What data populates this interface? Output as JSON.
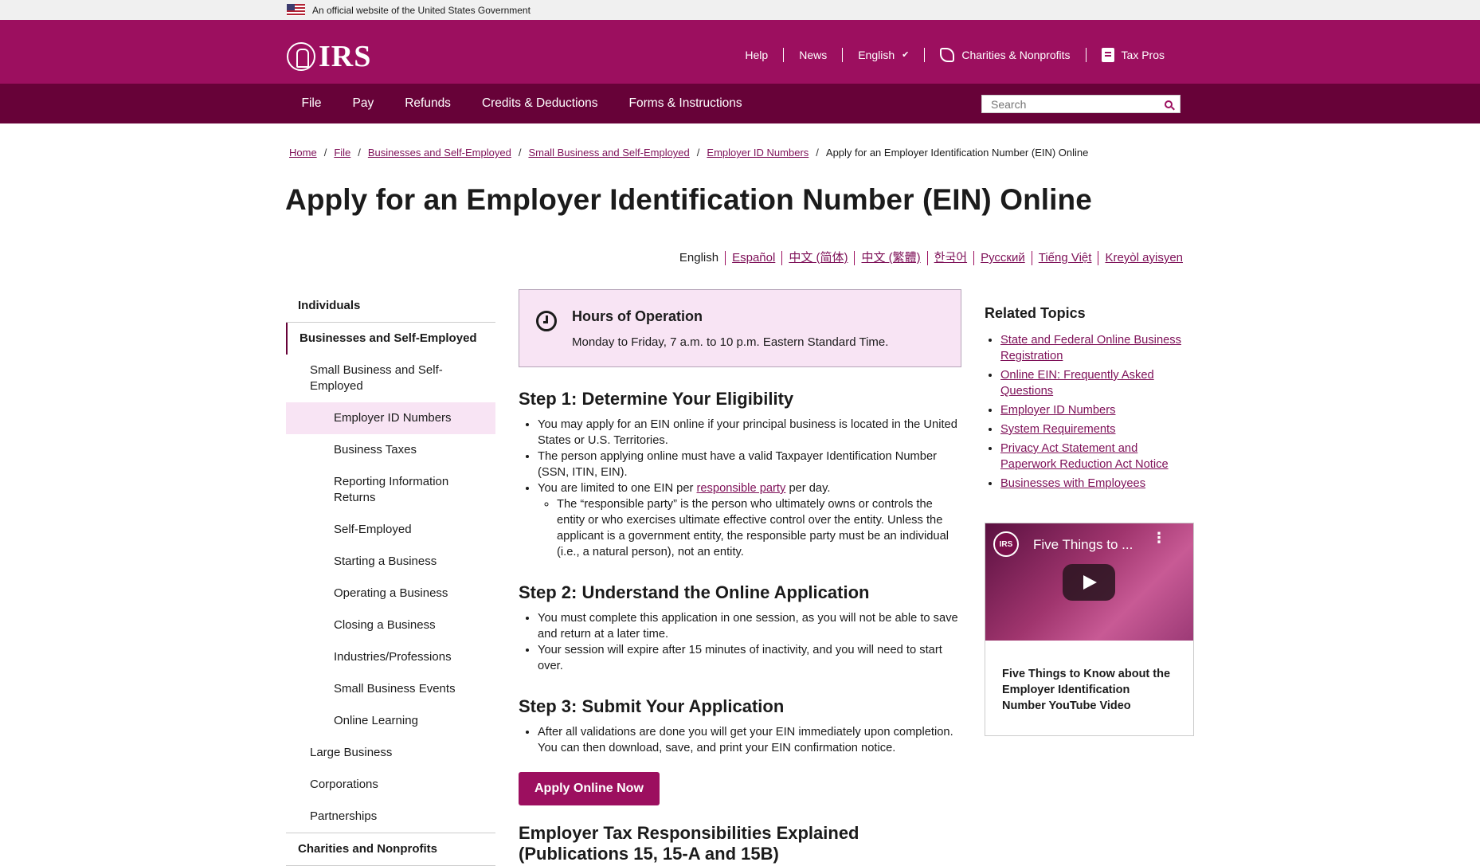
{
  "gov_banner": {
    "text": "An official website of the United States Government"
  },
  "header": {
    "logo_text": "IRS",
    "utility": [
      {
        "label": "Help"
      },
      {
        "label": "News"
      },
      {
        "label": "English"
      },
      {
        "label": "Charities & Nonprofits"
      },
      {
        "label": "Tax Pros"
      }
    ]
  },
  "nav": {
    "items": [
      "File",
      "Pay",
      "Refunds",
      "Credits & Deductions",
      "Forms & Instructions"
    ],
    "search_placeholder": "Search"
  },
  "breadcrumb": {
    "links": [
      "Home",
      "File",
      "Businesses and Self-Employed",
      "Small Business and Self-Employed",
      "Employer ID Numbers"
    ],
    "current": "Apply for an Employer Identification Number (EIN) Online"
  },
  "page_title": "Apply for an Employer Identification Number (EIN) Online",
  "languages": [
    "English",
    "Español",
    "中文 (简体)",
    "中文 (繁體)",
    "한국어",
    "Русский",
    "Tiếng Việt",
    "Kreyòl ayisyen"
  ],
  "sidebar": {
    "items": [
      "Individuals",
      "Businesses and Self-Employed",
      "Small Business and Self-Employed",
      "Employer ID Numbers",
      "Business Taxes",
      "Reporting Information Returns",
      "Self-Employed",
      "Starting a Business",
      "Operating a Business",
      "Closing a Business",
      "Industries/Professions",
      "Small Business Events",
      "Online Learning",
      "Large Business",
      "Corporations",
      "Partnerships",
      "Charities and Nonprofits"
    ]
  },
  "hours": {
    "title": "Hours of Operation",
    "text": "Monday to Friday, 7 a.m. to 10 p.m. Eastern Standard Time."
  },
  "step1": {
    "heading": "Step 1: Determine Your Eligibility",
    "b1": "You may apply for an EIN online if your principal business is located in the United States or U.S. Territories.",
    "b2": "The person applying online must have a valid Taxpayer Identification Number (SSN, ITIN, EIN).",
    "b3_pre": "You are limited to one EIN per ",
    "b3_link": "responsible party",
    "b3_post": " per day.",
    "sub1": "The “responsible party” is the person who ultimately owns or controls the entity or who exercises ultimate effective control over the entity. Unless the applicant is a government entity, the responsible party must be an individual (i.e., a natural person), not an entity."
  },
  "step2": {
    "heading": "Step 2: Understand the Online Application",
    "b1": "You must complete this application in one session, as you will not be able to save and return at a later time.",
    "b2": "Your session will expire after 15 minutes of inactivity, and you will need to start over."
  },
  "step3": {
    "heading": "Step 3: Submit Your Application",
    "b1": "After all validations are done you will get your EIN immediately upon completion. You can then download, save, and print your EIN confirmation notice."
  },
  "apply_button": "Apply Online Now",
  "employer_heading": "Employer Tax Responsibilities Explained (Publications 15, 15-A and 15B)",
  "related": {
    "title": "Related Topics",
    "links": [
      "State and Federal Online Business Registration",
      "Online EIN: Frequently Asked Questions",
      "Employer ID Numbers",
      "System Requirements",
      "Privacy Act Statement and Paperwork Reduction Act Notice",
      "Businesses with Employees"
    ]
  },
  "video": {
    "logo": "IRS",
    "thumb_title": "Five Things to ...",
    "caption": "Five Things to Know about the Employer Identification Number YouTube Video"
  },
  "colors": {
    "header": "#9c0f5f",
    "nav": "#670238",
    "accent_bg": "#f8e4f4"
  }
}
